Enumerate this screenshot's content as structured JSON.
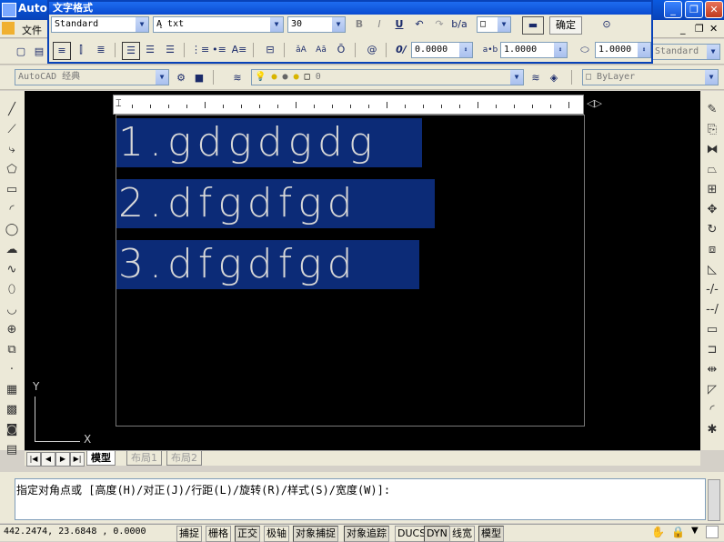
{
  "app": {
    "title": "Auto"
  },
  "menu": {
    "file": "文件"
  },
  "text_format": {
    "title": "文字格式",
    "style": "Standard",
    "font": "txt",
    "height": "30",
    "bold": "B",
    "italic": "I",
    "underline": "U",
    "ok": "确定",
    "oblique": "0.0000",
    "tracking": "1.0000",
    "width_factor": "1.0000"
  },
  "toolbar2": {
    "dimstyle": "Standard"
  },
  "workspace": {
    "name": "AutoCAD 经典",
    "layer": "0",
    "color": "ByLayer"
  },
  "drawing": {
    "lines": [
      "1.gdgdgdg",
      "2.dfgdfgd",
      "3.dfgdfgd"
    ],
    "ucs_y": "Y",
    "ucs_x": "X"
  },
  "tabs": {
    "items": [
      "模型",
      "布局1",
      "布局2"
    ]
  },
  "command": {
    "prompt": "指定对角点或 [高度(H)/对正(J)/行距(L)/旋转(R)/样式(S)/宽度(W)]:"
  },
  "status": {
    "coords": "442.2474, 23.6848 , 0.0000",
    "buttons": [
      "捕捉",
      "栅格",
      "正交",
      "极轴",
      "对象捕捉",
      "对象追踪",
      "DUCS",
      "DYN",
      "线宽",
      "模型"
    ]
  },
  "colors": {
    "selection": "#0c2b77",
    "canvas": "#000000",
    "titlebar": "#0842b8"
  }
}
